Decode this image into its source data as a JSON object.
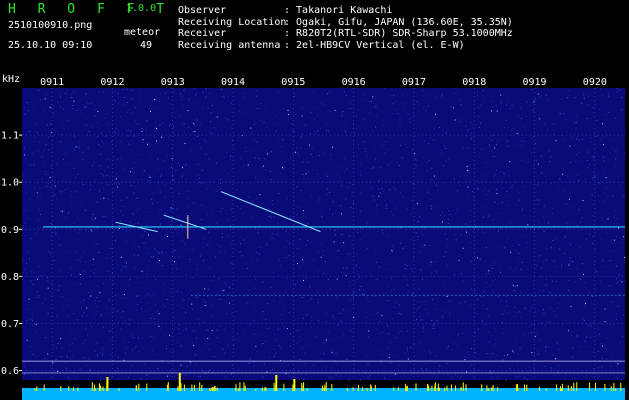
{
  "header": {
    "app_name": "H R O F F T",
    "version": "1.0.0",
    "filename": "2510100910.png",
    "datetime": "25.10.10 09:10",
    "meteor_label": "meteor",
    "meteor_count": "49",
    "info": [
      {
        "label": "Observer",
        "value": ": Takanori Kawachi"
      },
      {
        "label": "Receiving Location",
        "value": ": Ogaki, Gifu, JAPAN (136.60E, 35.35N)"
      },
      {
        "label": "Receiver",
        "value": ": R820T2(RTL-SDR) SDR-Sharp 53.1000MHz"
      },
      {
        "label": "Receiving antenna",
        "value": ": 2el-HB9CV Vertical (el. E-W)"
      }
    ]
  },
  "colors": {
    "background": "#000000",
    "spectrogram_bg": "#0a0a78",
    "title_green": "#2de52d",
    "signal": "#30d0ff",
    "bottom_bar": "#00b4ff",
    "bottom_peaks": "#ffff00"
  },
  "chart_data": {
    "type": "heatmap",
    "y_unit": "kHz",
    "x_tick_labels": [
      "0911",
      "0912",
      "0913",
      "0914",
      "0915",
      "0916",
      "0917",
      "0918",
      "0919",
      "0920"
    ],
    "y_tick_labels": [
      "1.1",
      "1.0",
      "0.9",
      "0.8",
      "0.7",
      "0.6"
    ],
    "y_ticks": [
      1.1,
      1.0,
      0.9,
      0.8,
      0.7,
      0.6
    ],
    "y_range": [
      0.58,
      1.2
    ],
    "x_range_minutes": [
      0,
      10
    ],
    "carrier_frequency_khz": 0.905,
    "meteor_echoes": [
      {
        "start_min": 2.35,
        "end_min": 3.05,
        "freq_start": 0.93,
        "freq_end": 0.9
      },
      {
        "start_min": 3.3,
        "end_min": 4.95,
        "freq_start": 0.98,
        "freq_end": 0.895
      },
      {
        "start_min": 1.55,
        "end_min": 2.25,
        "freq_start": 0.915,
        "freq_end": 0.895
      }
    ]
  }
}
